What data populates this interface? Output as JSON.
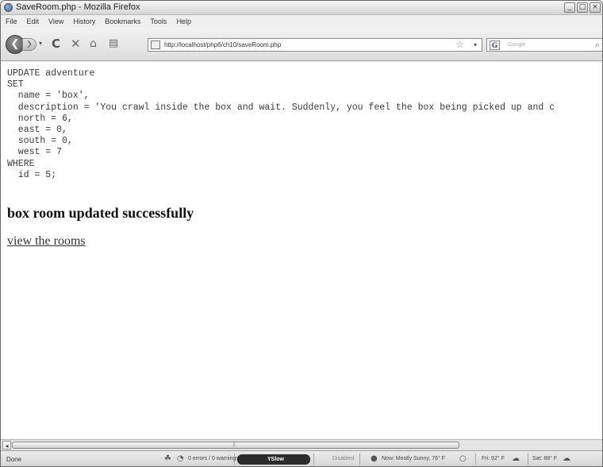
{
  "window": {
    "title": "SaveRoom.php - Mozilla Firefox",
    "controls": [
      "_",
      "□",
      "×"
    ]
  },
  "menu": {
    "items": [
      "File",
      "Edit",
      "View",
      "History",
      "Bookmarks",
      "Tools",
      "Help"
    ]
  },
  "nav": {
    "url": "http://localhost/php6/ch10/saveRoom.php",
    "search_placeholder": "Google"
  },
  "content": {
    "sql_lines": [
      "UPDATE adventure",
      "SET",
      "  name = 'box',",
      "  description = 'You crawl inside the box and wait. Suddenly, you feel the box being picked up and c",
      "  north = 6,",
      "  east = 0,",
      "  south = 0,",
      "  west = 7",
      "WHERE",
      "  id = 5;"
    ],
    "result_heading": "box room updated successfully",
    "rooms_link": "view the rooms"
  },
  "status": {
    "done": "Done",
    "errors": "0 errors / 0 warnings",
    "yslow": "YSlow",
    "disabled": "Disabled",
    "weather_now": "Now: Mostly Sunny, 76° F",
    "weather_fri": "Fri: 92° F",
    "weather_sat": "Sat: 88° F"
  }
}
